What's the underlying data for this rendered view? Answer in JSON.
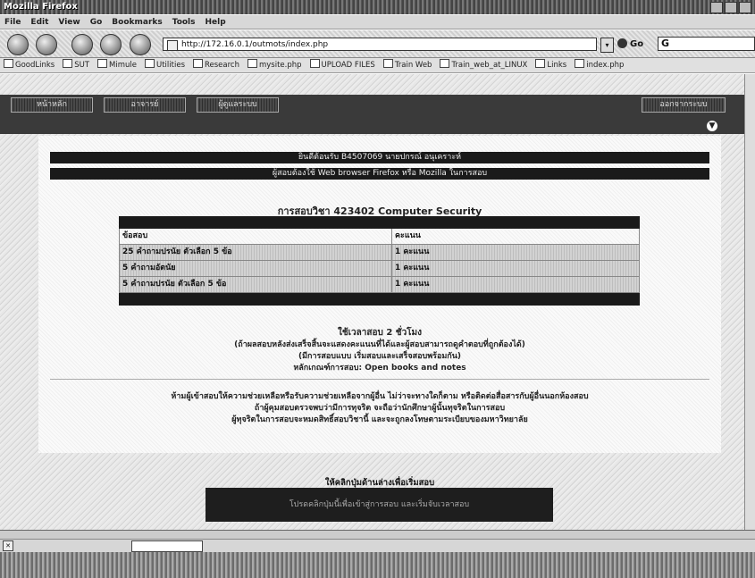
{
  "window": {
    "title": "Mozilla Firefox"
  },
  "menu": [
    "File",
    "Edit",
    "View",
    "Go",
    "Bookmarks",
    "Tools",
    "Help"
  ],
  "navigation": {
    "url": "http://172.16.0.1/outmots/index.php",
    "go_label": "Go",
    "search_value": "G"
  },
  "bookmarks": [
    "GoodLinks",
    "SUT",
    "Mimule",
    "Utilities",
    "Research",
    "mysite.php",
    "UPLOAD FILES",
    "Train Web",
    "Train_web_at_LINUX",
    "Links",
    "index.php"
  ],
  "site_nav": {
    "tabs": [
      "หน้าหลัก",
      "อาจารย์",
      "ผู้ดูแลระบบ"
    ],
    "logout": "ออกจากระบบ"
  },
  "banner": {
    "login_line": "ยินดีต้อนรับ B4507069 นายปกรณ์ อนุเคราะห์",
    "browser_note": "ผู้สอบต้องใช้ Web browser Firefox หรือ Mozilla ในการสอบ"
  },
  "course": {
    "title": "การสอบวิชา 423402 Computer Security"
  },
  "exam_table": {
    "headers": [
      "ข้อสอบ",
      "คะแนน"
    ],
    "rows": [
      {
        "section": "25 คำถามปรนัย ตัวเลือก 5 ข้อ",
        "points": "1 คะแนน"
      },
      {
        "section": "5 คำถามอัตนัย",
        "points": "1 คะแนน"
      },
      {
        "section": "5 คำถามปรนัย ตัวเลือก 5 ข้อ",
        "points": "1 คะแนน"
      }
    ]
  },
  "instructions": {
    "duration": "ใช้เวลาสอบ 2 ชั่วโมง",
    "line1": "(ถ้าผลสอบหลังส่งเสร็จสิ้นจะแสดงคะแนนที่ได้และผู้สอบสามารถดูคำตอบที่ถูกต้องได้)",
    "line2": "(มีการสอบแบบ เริ่มสอบและเสร็จสอบพร้อมกัน)",
    "line3": "หลักเกณฑ์การสอบ: Open books and notes",
    "rule1": "ห้ามผู้เข้าสอบให้ความช่วยเหลือหรือรับความช่วยเหลือจากผู้อื่น ไม่ว่าจะทางใดก็ตาม หรือติดต่อสื่อสารกับผู้อื่นนอกห้องสอบ",
    "rule2": "ถ้าผู้คุมสอบตรวจพบว่ามีการทุจริต จะถือว่านักศึกษาผู้นั้นทุจริตในการสอบ",
    "rule3": "ผู้ทุจริตในการสอบจะหมดสิทธิ์สอบวิชานี้ และจะถูกลงโทษตามระเบียบของมหาวิทยาลัย"
  },
  "start": {
    "prompt": "ให้คลิกปุ่มด้านล่างเพื่อเริ่มสอบ",
    "button": "โปรดคลิกปุ่มนี้เพื่อเข้าสู่การสอบ และเริ่มจับเวลาสอบ"
  }
}
